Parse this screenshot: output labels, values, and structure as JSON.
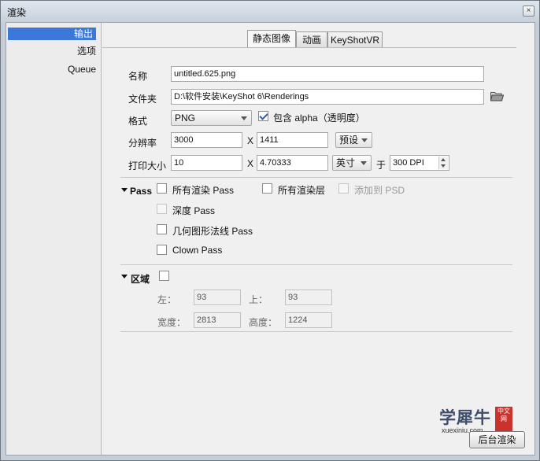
{
  "window": {
    "title": "渲染",
    "close_label": "×"
  },
  "sidebar": {
    "items": [
      {
        "label": "输出",
        "active": true
      },
      {
        "label": "选项",
        "active": false
      },
      {
        "label": "Queue",
        "active": false
      }
    ]
  },
  "tabs": [
    {
      "label": "静态图像",
      "active": true
    },
    {
      "label": "动画",
      "active": false
    },
    {
      "label": "KeyShotVR",
      "active": false
    }
  ],
  "form": {
    "name_label": "名称",
    "name_value": "untitled.625.png",
    "folder_label": "文件夹",
    "folder_value": "D:\\软件安装\\KeyShot 6\\Renderings",
    "format_label": "格式",
    "format_value": "PNG",
    "alpha_label": "包含 alpha（透明度）",
    "alpha_checked": true,
    "resolution_label": "分辨率",
    "res_width": "3000",
    "res_x": "X",
    "res_height": "1411",
    "preset_label": "预设",
    "print_label": "打印大小",
    "print_width": "10",
    "print_x": "X",
    "print_height": "4.70333",
    "unit_value": "英寸",
    "at_label": "于",
    "dpi_value": "300 DPI"
  },
  "pass": {
    "title": "Pass",
    "all_pass": "所有渲染 Pass",
    "all_layers": "所有渲染层",
    "add_psd": "添加到 PSD",
    "depth": "深度 Pass",
    "normals": "几何图形法线 Pass",
    "clown": "Clown Pass"
  },
  "region": {
    "title": "区域",
    "left_label": "左：",
    "left_value": "93",
    "top_label": "上：",
    "top_value": "93",
    "width_label": "宽度：",
    "width_value": "2813",
    "height_label": "高度：",
    "height_value": "1224"
  },
  "footer": {
    "background_render_label": "后台渲染"
  },
  "watermark": {
    "text": "学犀牛",
    "badge": "中文网",
    "url": "xuexiniu.com"
  },
  "colors": {
    "accent": "#3b78d8",
    "check": "#2a5dbb",
    "watermark_red": "#c9332c"
  }
}
